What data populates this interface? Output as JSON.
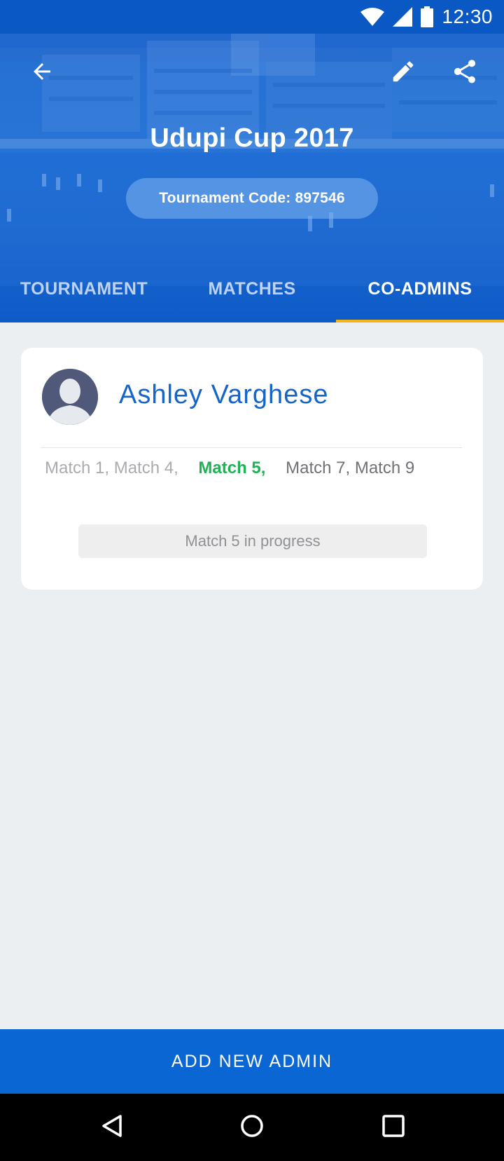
{
  "status_bar": {
    "time": "12:30",
    "icons": [
      "wifi-icon",
      "signal-icon",
      "battery-icon"
    ]
  },
  "header": {
    "title": "Udupi Cup 2017",
    "tournament_code": "Tournament Code: 897546",
    "icons": {
      "back": "arrow-back-icon",
      "edit": "pencil-icon",
      "share": "share-icon"
    }
  },
  "tabs": [
    {
      "label": "TOURNAMENT",
      "active": false
    },
    {
      "label": "MATCHES",
      "active": false
    },
    {
      "label": "CO-ADMINS",
      "active": true
    }
  ],
  "admin_card": {
    "name": "Ashley Varghese",
    "matches_done": "Match 1, Match 4,",
    "match_current": "Match 5,",
    "matches_upcoming": "Match 7, Match 9",
    "status": "Match 5 in progress"
  },
  "add_button_label": "ADD NEW ADMIN",
  "colors": {
    "primary": "#0a66d2",
    "tab_indicator": "#f5b21b",
    "current_match": "#21b256",
    "admin_name": "#1565c8",
    "background": "#eceff2"
  },
  "nav_bar": {
    "icons": [
      "back-triangle-icon",
      "home-circle-icon",
      "recents-square-icon"
    ]
  }
}
